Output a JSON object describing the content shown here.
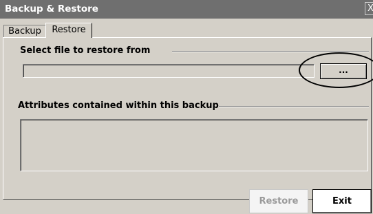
{
  "window": {
    "title": "Backup & Restore",
    "close_glyph": "X"
  },
  "tabs": [
    {
      "label": "Backup",
      "active": false
    },
    {
      "label": "Restore",
      "active": true
    }
  ],
  "restore": {
    "select_file_label": "Select file to restore from",
    "file_path_value": "",
    "browse_label": "...",
    "attributes_label": "Attributes contained within this backup",
    "attributes_content": ""
  },
  "buttons": {
    "restore_label": "Restore",
    "restore_enabled": false,
    "exit_label": "Exit"
  },
  "icons": {
    "close": "close-icon"
  }
}
